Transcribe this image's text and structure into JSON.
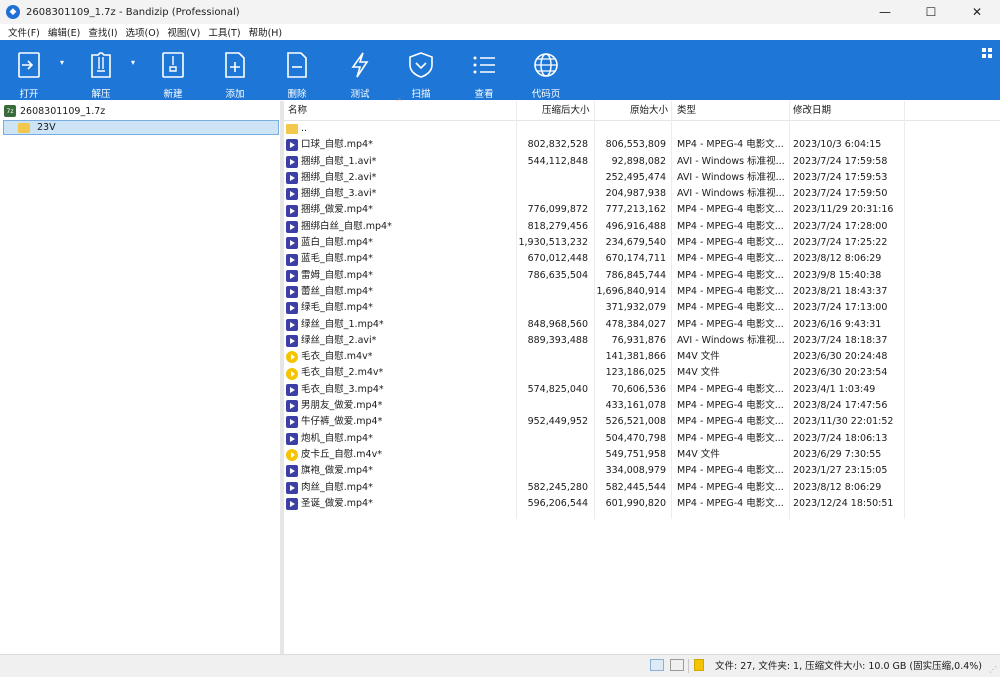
{
  "window": {
    "title": "2608301109_1.7z - Bandizip (Professional)",
    "minimize_glyph": "—",
    "maximize_glyph": "☐",
    "close_glyph": "✕"
  },
  "menu": [
    "文件(F)",
    "编辑(E)",
    "查找(I)",
    "选项(O)",
    "视图(V)",
    "工具(T)",
    "帮助(H)"
  ],
  "toolbar": {
    "open": "打开",
    "extract": "解压",
    "new": "新建",
    "add": "添加",
    "delete": "删除",
    "test": "测试",
    "scan": "扫描",
    "view": "查看",
    "codepage": "代码页"
  },
  "tree": {
    "root": "2608301109_1.7z",
    "folder": "23V"
  },
  "columns": {
    "name": "名称",
    "compressed": "压缩后大小",
    "original": "原始大小",
    "type": "类型",
    "modified": "修改日期"
  },
  "files": [
    {
      "name": "..",
      "icon": "folder",
      "compressed": "",
      "original": "",
      "type": "",
      "date": ""
    },
    {
      "name": "口球_自慰.mp4*",
      "icon": "video",
      "compressed": "802,832,528",
      "original": "806,553,809",
      "type": "MP4 - MPEG-4 电影文...",
      "date": "2023/10/3 6:04:15"
    },
    {
      "name": "捆绑_自慰_1.avi*",
      "icon": "video",
      "compressed": "544,112,848",
      "original": "92,898,082",
      "type": "AVI - Windows 标准视...",
      "date": "2023/7/24 17:59:58"
    },
    {
      "name": "捆绑_自慰_2.avi*",
      "icon": "video",
      "compressed": "",
      "original": "252,495,474",
      "type": "AVI - Windows 标准视...",
      "date": "2023/7/24 17:59:53"
    },
    {
      "name": "捆绑_自慰_3.avi*",
      "icon": "video",
      "compressed": "",
      "original": "204,987,938",
      "type": "AVI - Windows 标准视...",
      "date": "2023/7/24 17:59:50"
    },
    {
      "name": "捆绑_做爱.mp4*",
      "icon": "video",
      "compressed": "776,099,872",
      "original": "777,213,162",
      "type": "MP4 - MPEG-4 电影文...",
      "date": "2023/11/29 20:31:16"
    },
    {
      "name": "捆绑白丝_自慰.mp4*",
      "icon": "video",
      "compressed": "818,279,456",
      "original": "496,916,488",
      "type": "MP4 - MPEG-4 电影文...",
      "date": "2023/7/24 17:28:00"
    },
    {
      "name": "蓝白_自慰.mp4*",
      "icon": "video",
      "compressed": "1,930,513,232",
      "original": "234,679,540",
      "type": "MP4 - MPEG-4 电影文...",
      "date": "2023/7/24 17:25:22"
    },
    {
      "name": "蓝毛_自慰.mp4*",
      "icon": "video",
      "compressed": "670,012,448",
      "original": "670,174,711",
      "type": "MP4 - MPEG-4 电影文...",
      "date": "2023/8/12 8:06:29"
    },
    {
      "name": "雷姆_自慰.mp4*",
      "icon": "video",
      "compressed": "786,635,504",
      "original": "786,845,744",
      "type": "MP4 - MPEG-4 电影文...",
      "date": "2023/9/8 15:40:38"
    },
    {
      "name": "蕾丝_自慰.mp4*",
      "icon": "video",
      "compressed": "",
      "original": "1,696,840,914",
      "type": "MP4 - MPEG-4 电影文...",
      "date": "2023/8/21 18:43:37"
    },
    {
      "name": "绿毛_自慰.mp4*",
      "icon": "video",
      "compressed": "",
      "original": "371,932,079",
      "type": "MP4 - MPEG-4 电影文...",
      "date": "2023/7/24 17:13:00"
    },
    {
      "name": "绿丝_自慰_1.mp4*",
      "icon": "video",
      "compressed": "848,968,560",
      "original": "478,384,027",
      "type": "MP4 - MPEG-4 电影文...",
      "date": "2023/6/16 9:43:31"
    },
    {
      "name": "绿丝_自慰_2.avi*",
      "icon": "video",
      "compressed": "889,393,488",
      "original": "76,931,876",
      "type": "AVI - Windows 标准视...",
      "date": "2023/7/24 18:18:37"
    },
    {
      "name": "毛衣_自慰.m4v*",
      "icon": "m4v",
      "compressed": "",
      "original": "141,381,866",
      "type": "M4V 文件",
      "date": "2023/6/30 20:24:48"
    },
    {
      "name": "毛衣_自慰_2.m4v*",
      "icon": "m4v",
      "compressed": "",
      "original": "123,186,025",
      "type": "M4V 文件",
      "date": "2023/6/30 20:23:54"
    },
    {
      "name": "毛衣_自慰_3.mp4*",
      "icon": "video",
      "compressed": "574,825,040",
      "original": "70,606,536",
      "type": "MP4 - MPEG-4 电影文...",
      "date": "2023/4/1 1:03:49"
    },
    {
      "name": "男朋友_做爱.mp4*",
      "icon": "video",
      "compressed": "",
      "original": "433,161,078",
      "type": "MP4 - MPEG-4 电影文...",
      "date": "2023/8/24 17:47:56"
    },
    {
      "name": "牛仔裤_做爱.mp4*",
      "icon": "video",
      "compressed": "952,449,952",
      "original": "526,521,008",
      "type": "MP4 - MPEG-4 电影文...",
      "date": "2023/11/30 22:01:52"
    },
    {
      "name": "炮机_自慰.mp4*",
      "icon": "video",
      "compressed": "",
      "original": "504,470,798",
      "type": "MP4 - MPEG-4 电影文...",
      "date": "2023/7/24 18:06:13"
    },
    {
      "name": "皮卡丘_自慰.m4v*",
      "icon": "m4v",
      "compressed": "",
      "original": "549,751,958",
      "type": "M4V 文件",
      "date": "2023/6/29 7:30:55"
    },
    {
      "name": "旗袍_做爱.mp4*",
      "icon": "video",
      "compressed": "",
      "original": "334,008,979",
      "type": "MP4 - MPEG-4 电影文...",
      "date": "2023/1/27 23:15:05"
    },
    {
      "name": "肉丝_自慰.mp4*",
      "icon": "video",
      "compressed": "582,245,280",
      "original": "582,445,544",
      "type": "MP4 - MPEG-4 电影文...",
      "date": "2023/8/12 8:06:29"
    },
    {
      "name": "圣诞_做爱.mp4*",
      "icon": "video",
      "compressed": "596,206,544",
      "original": "601,990,820",
      "type": "MP4 - MPEG-4 电影文...",
      "date": "2023/12/24 18:50:51"
    }
  ],
  "status": {
    "summary": "文件: 27, 文件夹: 1, 压缩文件大小: 10.0 GB (固实压缩,0.4%)"
  },
  "colors": {
    "toolbar": "#1e77d6",
    "selection": "#cde4f7",
    "selection_border": "#7aaee0"
  }
}
